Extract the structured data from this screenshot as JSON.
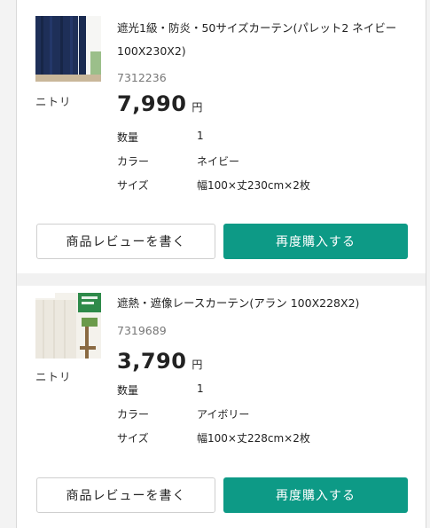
{
  "items": [
    {
      "brand": "ニトリ",
      "name": "遮光1級・防炎・50サイズカーテン(パレット2 ネイビー 100X230X2)",
      "code": "7312236",
      "price": "7,990",
      "currency": "円",
      "attributes": [
        {
          "label": "数量",
          "value": "1"
        },
        {
          "label": "カラー",
          "value": "ネイビー"
        },
        {
          "label": "サイズ",
          "value": "幅100×丈230cm×2枚"
        }
      ],
      "review_button": "商品レビューを書く",
      "rebuy_button": "再度購入する"
    },
    {
      "brand": "ニトリ",
      "name": "遮熱・遮像レースカーテン(アラン 100X228X2)",
      "code": "7319689",
      "price": "3,790",
      "currency": "円",
      "attributes": [
        {
          "label": "数量",
          "value": "1"
        },
        {
          "label": "カラー",
          "value": "アイボリー"
        },
        {
          "label": "サイズ",
          "value": "幅100×丈228cm×2枚"
        }
      ],
      "review_button": "商品レビューを書く",
      "rebuy_button": "再度購入する"
    }
  ],
  "colors": {
    "accent": "#0d9a86",
    "navy_curtain": "#1e2f58"
  }
}
